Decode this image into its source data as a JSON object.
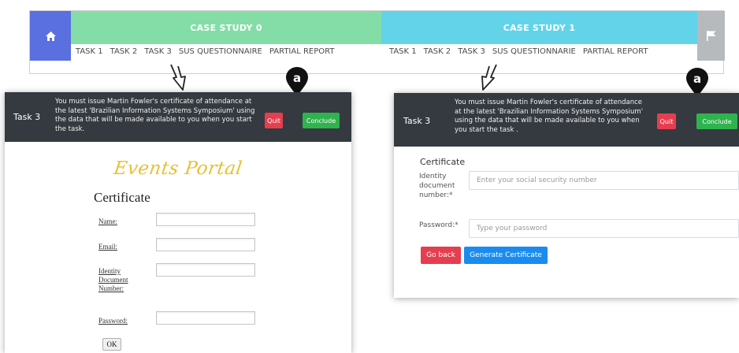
{
  "nav": {
    "case_study_0": "CASE STUDY 0",
    "case_study_1": "CASE STUDY 1",
    "tasks_0": [
      "TASK 1",
      "TASK 2",
      "TASK 3",
      "SUS QUESTIONNAIRE",
      "PARTIAL REPORT"
    ],
    "tasks_1": [
      "TASK 1",
      "TASK 2",
      "TASK 3",
      "SUS QUESTIONNARIE",
      "PARTIAL REPORT"
    ],
    "icons": {
      "home": "home-icon",
      "flag": "flag-icon"
    },
    "colors": {
      "home": "#5a6fe0",
      "case_study_0": "#84dda6",
      "case_study_1": "#63d3ea",
      "flag": "#b7babd"
    }
  },
  "markers": {
    "label": "a"
  },
  "left_panel": {
    "task_label": "Task 3",
    "description": [
      "You must issue Martin Fowler's certificate of attendance at",
      "the latest 'Brazilian Information Systems Symposium' using",
      "the data that will be made available to you when you start",
      "the task."
    ],
    "quit_label": "Quit",
    "conclude_label": "Conclude",
    "portal_title": "Events Portal",
    "heading": "Certificate",
    "fields": {
      "name": "Name:",
      "email": "Email:",
      "identity": [
        "Identity",
        "Document",
        "Number:"
      ],
      "password": "Password:"
    },
    "ok_label": "OK"
  },
  "right_panel": {
    "task_label": "Task 3",
    "description": [
      "You must issue Martin Fowler's certificate of attendance",
      "at the latest 'Brazilian Information Systems Symposium'",
      "using the data that will be made available to you when",
      "you start the task ."
    ],
    "quit_label": "Quit",
    "conclude_label": "Conclude",
    "heading": "Certificate",
    "identity_label": [
      "Identity",
      "document",
      "number:*"
    ],
    "identity_placeholder": "Enter your social security number",
    "password_label": "Password:*",
    "password_placeholder": "Type your password",
    "go_back_label": "Go back",
    "generate_label": "Generate Certificate"
  }
}
